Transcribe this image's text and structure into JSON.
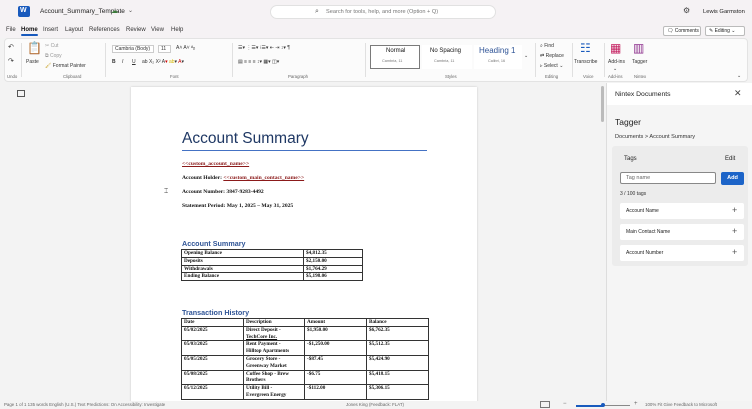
{
  "app": {
    "doc_title": "Account_Summary_Template",
    "search_placeholder": "Search for tools, help, and more (Option + Q)",
    "user_name": "Lewis Garmston"
  },
  "menu": {
    "tabs": [
      "File",
      "Home",
      "Insert",
      "Layout",
      "References",
      "Review",
      "View",
      "Help"
    ],
    "comments_label": "Comments",
    "editing_label": "Editing"
  },
  "ribbon": {
    "undo_group": "Undo",
    "clipboard": {
      "paste": "Paste",
      "cut": "Cut",
      "copy": "Copy",
      "format_painter": "Format Painter",
      "group": "Clipboard"
    },
    "font": {
      "name": "Cambria (Body)",
      "size": "11",
      "group": "Font",
      "bold": "B",
      "italic": "I",
      "underline": "U"
    },
    "paragraph_group": "Paragraph",
    "styles": [
      {
        "name": "Normal",
        "sub": "Cambria, 11"
      },
      {
        "name": "No Spacing",
        "sub": "Cambria, 11"
      },
      {
        "name": "Heading 1",
        "sub": "Calibri, 16"
      }
    ],
    "styles_group": "Styles",
    "editing": {
      "find": "Find",
      "replace": "Replace",
      "select": "Select",
      "group": "Editing"
    },
    "voice": {
      "label": "Transcribe",
      "group": "Voice"
    },
    "addins": {
      "label": "Add-ins",
      "group": "Add-ins"
    },
    "tagger": {
      "label": "Tagger",
      "group": "Nintex"
    }
  },
  "document": {
    "title": "Account Summary",
    "field_name": "<<custom_account_name>>",
    "holder_prefix": "Account Holder: ",
    "holder_field": "<<custom_main_contact_name>>",
    "account_number": "Account Number: 3847-9283-4492",
    "statement_period": "Statement Period: May 1, 2025 – May 31, 2025",
    "summary_heading": "Account Summary",
    "summary_rows": [
      [
        "Opening Balance",
        "$4,812.35"
      ],
      [
        "Deposits",
        "$2,150.00"
      ],
      [
        "Withdrawals",
        "$1,764.29"
      ],
      [
        "Ending Balance",
        "$5,198.06"
      ]
    ],
    "tx_heading": "Transaction History",
    "tx_headers": [
      "Date",
      "Description",
      "Amount",
      "Balance"
    ],
    "tx_rows": [
      [
        "05/02/2025",
        "Direct Deposit -",
        "TechCore Inc.",
        "$1,950.00",
        "$6,762.35"
      ],
      [
        "05/03/2025",
        "Rent Payment -",
        "Hilltop Apartments",
        "-$1,250.00",
        "$5,512.35"
      ],
      [
        "05/05/2025",
        "Grocery Store -",
        "Greenway Market",
        "-$87.45",
        "$5,424.90"
      ],
      [
        "05/08/2025",
        "Coffee Shop - Brew",
        "Brothers",
        "-$6.75",
        "$5,418.15"
      ],
      [
        "05/12/2025",
        "Utility Bill -",
        "Evergreen Energy",
        "-$112.00",
        "$5,306.15"
      ]
    ]
  },
  "panel": {
    "title": "Nintex Documents",
    "tagger_title": "Tagger",
    "breadcrumb": "Documents > Account Summary",
    "tags_label": "Tags",
    "edit_label": "Edit",
    "tag_input_placeholder": "Tag name",
    "add_label": "Add",
    "tag_count": "3 / 100 tags",
    "tags": [
      "Account Name",
      "Main Contact Name",
      "Account Number"
    ]
  },
  "status": {
    "left": "Page 1 of 1   135 words   English (U.S.)   Text Predictions: On   Accessibility: Investigate",
    "mid": "Jones King (Feedback: FLAT)",
    "right": "100%   Fit   Give Feedback to Microsoft"
  },
  "zoom_level": 0.5
}
